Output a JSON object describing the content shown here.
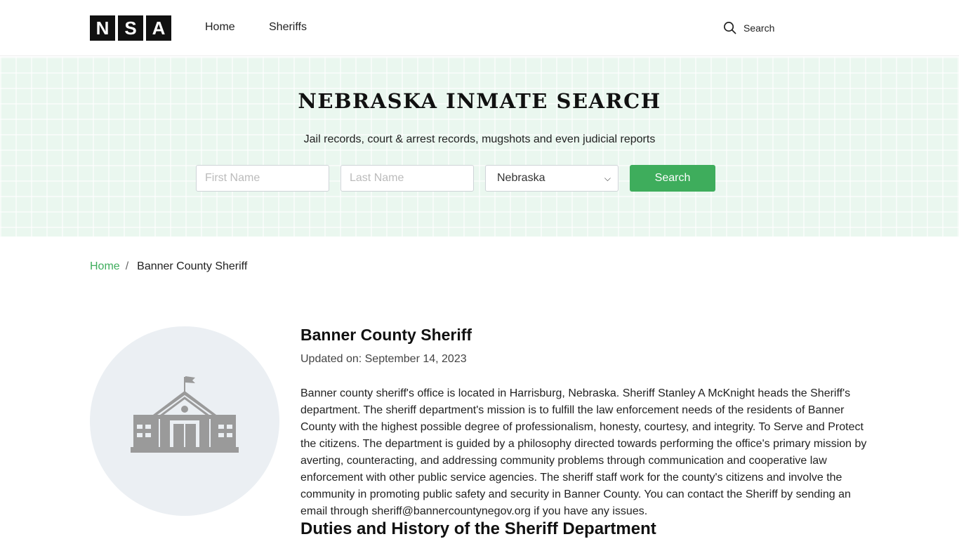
{
  "header": {
    "logo_letters": [
      "N",
      "S",
      "A"
    ],
    "nav": {
      "home_label": "Home",
      "sheriffs_label": "Sheriffs"
    },
    "search_label": "Search"
  },
  "hero": {
    "title": "NEBRASKA INMATE SEARCH",
    "subtitle": "Jail records, court & arrest records, mugshots and even judicial reports",
    "first_name_placeholder": "First Name",
    "last_name_placeholder": "Last Name",
    "state_selected": "Nebraska",
    "search_button_label": "Search"
  },
  "breadcrumb": {
    "home_label": "Home",
    "separator": "/",
    "current": "Banner County Sheriff"
  },
  "main": {
    "title": "Banner County Sheriff",
    "updated": "Updated on: September 14, 2023",
    "description": "Banner county sheriff's office is located in Harrisburg, Nebraska. Sheriff Stanley A McKnight heads the Sheriff's department. The sheriff department's mission is to fulfill the law enforcement needs of the residents of Banner County with the highest possible degree of professionalism, honesty, courtesy, and integrity. To Serve and Protect the citizens. The department is guided by a philosophy directed towards performing the office's primary mission by averting, counteracting, and addressing community problems through communication and cooperative law enforcement with other public service agencies. The sheriff staff work for the county's citizens and involve the community in promoting public safety and security in Banner County. You can contact the Sheriff by sending an email through sheriff@bannercountynegov.org if you have any issues.",
    "section_heading": "Duties and History of the Sheriff Department"
  },
  "colors": {
    "accent": "#3ead5c",
    "hero_bg": "#eaf7ef",
    "logo_bg": "#111111",
    "icon_gray": "#9a9a9a"
  },
  "icons": {
    "header_search": "search-icon",
    "building": "courthouse-building-icon"
  }
}
